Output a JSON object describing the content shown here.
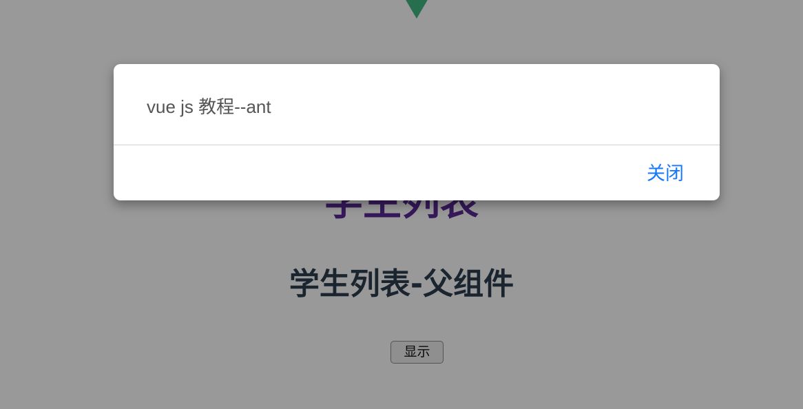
{
  "app": {
    "list_title": "学生列表",
    "parent_title": "学生列表-父组件",
    "show_button_label": "显示"
  },
  "modal": {
    "message": "vue js 教程--ant",
    "close_label": "关闭"
  },
  "colors": {
    "logo": "#42b883",
    "list_title": "#5b2a96",
    "parent_title": "#2c3e50",
    "close_link": "#1677ff"
  }
}
